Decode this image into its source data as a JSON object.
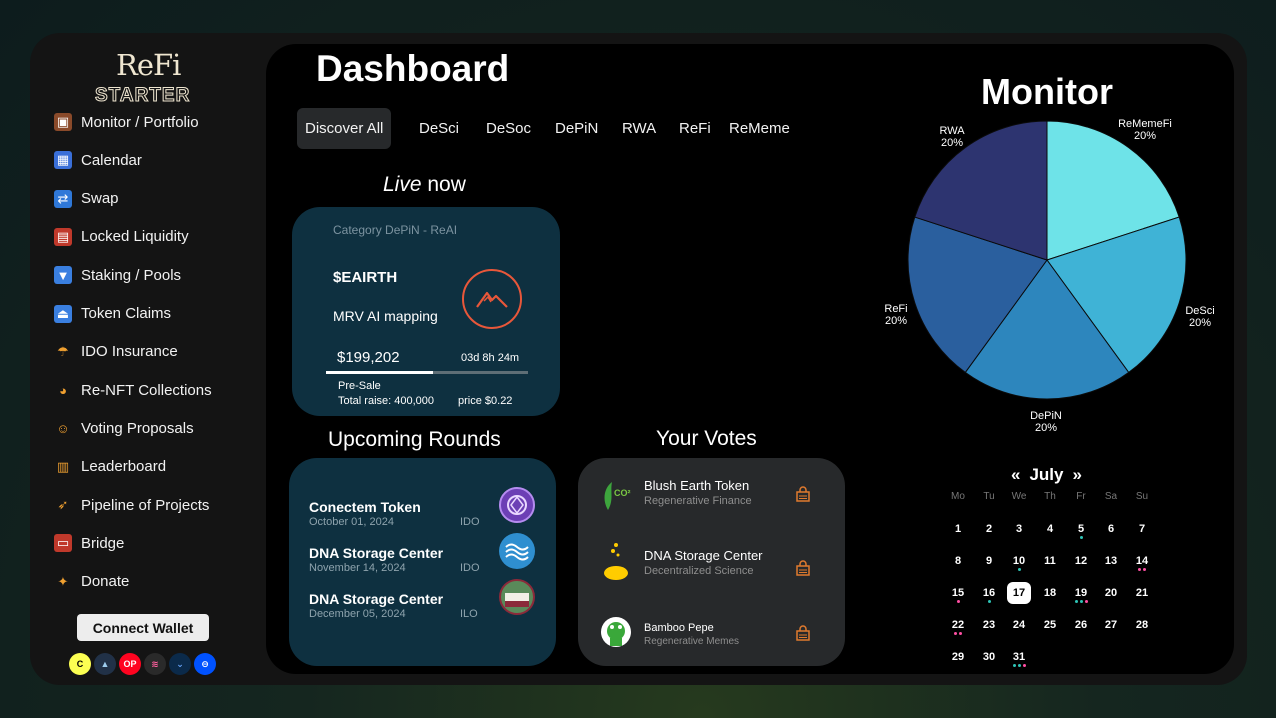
{
  "brand": {
    "logo_top": "ReFi",
    "logo_bottom": "STARTER"
  },
  "sidebar": {
    "items": [
      {
        "label": "Monitor / Portfolio",
        "icon": "briefcase-icon"
      },
      {
        "label": "Calendar",
        "icon": "calendar-icon"
      },
      {
        "label": "Swap",
        "icon": "swap-icon"
      },
      {
        "label": "Locked Liquidity",
        "icon": "abacus-icon"
      },
      {
        "label": "Staking / Pools",
        "icon": "download-icon"
      },
      {
        "label": "Token Claims",
        "icon": "eject-icon"
      },
      {
        "label": "IDO Insurance",
        "icon": "umbrella-icon"
      },
      {
        "label": "Re-NFT Collections",
        "icon": "palette-icon"
      },
      {
        "label": "Voting Proposals",
        "icon": "person-vote-icon"
      },
      {
        "label": "Leaderboard",
        "icon": "ladder-icon"
      },
      {
        "label": "Pipeline of Projects",
        "icon": "rocket-icon"
      },
      {
        "label": "Bridge",
        "icon": "bridge-icon"
      },
      {
        "label": "Donate",
        "icon": "ribbon-icon"
      }
    ],
    "connect_wallet": "Connect Wallet",
    "chains": [
      {
        "name": "celo-icon",
        "glyph": "C",
        "bg": "#fcff52",
        "fg": "#000"
      },
      {
        "name": "arbitrum-icon",
        "glyph": "▲",
        "bg": "#213147",
        "fg": "#9dcced"
      },
      {
        "name": "optimism-icon",
        "glyph": "OP",
        "bg": "#ff0420",
        "fg": "#fff"
      },
      {
        "name": "aurora-icon",
        "glyph": "≋",
        "bg": "#2a2a2a",
        "fg": "#ff5f9e"
      },
      {
        "name": "shield-chain-icon",
        "glyph": "⌄",
        "bg": "#0b2a4a",
        "fg": "#6aa7ff"
      },
      {
        "name": "base-icon",
        "glyph": "⊖",
        "bg": "#0052ff",
        "fg": "#fff"
      }
    ]
  },
  "dashboard": {
    "title": "Dashboard",
    "tabs": [
      "Discover All",
      "DeSci",
      "DeSoc",
      "DePiN",
      "RWA",
      "ReFi",
      "ReMeme"
    ],
    "live_word": "Live",
    "live_rest": " now",
    "live_card": {
      "category": "Category DePiN - ReAI",
      "token": "$EAIRTH",
      "description": "MRV AI mapping",
      "amount": "$199,202",
      "time_left": "03d 8h 24m",
      "progress": 0.53,
      "stage": "Pre-Sale",
      "total_raise": "Total raise: 400,000",
      "price": "price $0.22"
    },
    "upcoming_title": "Upcoming Rounds",
    "upcoming": [
      {
        "name": "Conectem Token",
        "date": "October 01, 2024",
        "kind": "IDO"
      },
      {
        "name": "DNA Storage Center",
        "date": "November 14, 2024",
        "kind": "IDO"
      },
      {
        "name": "DNA Storage Center",
        "date": "December 05, 2024",
        "kind": "ILO"
      }
    ],
    "votes_title": "Your Votes",
    "votes": [
      {
        "name": "Blush Earth Token",
        "sub": "Regenerative Finance"
      },
      {
        "name": "DNA Storage Center",
        "sub": "Decentralized Science"
      },
      {
        "name": "Bamboo Pepe",
        "sub": "Regenerative Memes"
      }
    ]
  },
  "monitor": {
    "title": "Monitor",
    "chart_data": {
      "type": "pie",
      "categories": [
        "ReMemeFi",
        "DeSci",
        "DePiN",
        "ReFi",
        "RWA"
      ],
      "values": [
        20,
        20,
        20,
        20,
        20
      ],
      "labels": [
        "20%",
        "20%",
        "20%",
        "20%",
        "20%"
      ],
      "colors": [
        "#6ee3e8",
        "#3fb3d6",
        "#2d86bd",
        "#2a5f9e",
        "#2d3470"
      ]
    }
  },
  "calendar": {
    "prev": "«",
    "month": "July",
    "next": "»",
    "weekdays": [
      "Mo",
      "Tu",
      "We",
      "Th",
      "Fr",
      "Sa",
      "Su"
    ],
    "today": "17",
    "weeks": [
      [
        "1",
        "2",
        "3",
        "4",
        "5",
        "6",
        "7"
      ],
      [
        "8",
        "9",
        "10",
        "11",
        "12",
        "13",
        "14"
      ],
      [
        "15",
        "16",
        "17",
        "18",
        "19",
        "20",
        "21"
      ],
      [
        "22",
        "23",
        "24",
        "25",
        "26",
        "27",
        "28"
      ],
      [
        "29",
        "30",
        "31",
        "",
        "",
        "",
        ""
      ]
    ],
    "dots": {
      "5": [
        "#2ec4b6"
      ],
      "10": [
        "#2ec4b6"
      ],
      "14": [
        "#ff4fa3",
        "#ff4fa3"
      ],
      "15": [
        "#ff4fa3"
      ],
      "16": [
        "#2ec4b6"
      ],
      "19": [
        "#2ec4b6",
        "#2ec4b6",
        "#ff4fa3"
      ],
      "22": [
        "#ff4fa3",
        "#ff4fa3"
      ],
      "31": [
        "#2ec4b6",
        "#2ec4b6",
        "#ff4fa3"
      ]
    }
  }
}
